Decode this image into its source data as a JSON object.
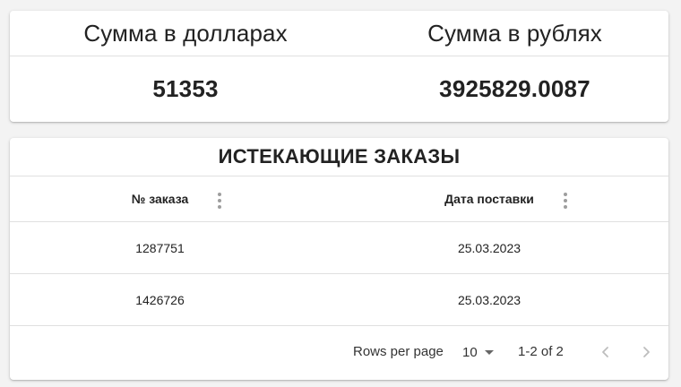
{
  "summary": {
    "usd_title": "Сумма в долларах",
    "rub_title": "Сумма в рублях",
    "usd_value": "51353",
    "rub_value": "3925829.0087"
  },
  "orders": {
    "title": "ИСТЕКАЮЩИЕ ЗАКАЗЫ",
    "columns": [
      "№ заказа",
      "Дата поставки"
    ],
    "rows": [
      {
        "order": "1287751",
        "date": "25.03.2023"
      },
      {
        "order": "1426726",
        "date": "25.03.2023"
      }
    ],
    "pagination": {
      "rows_per_page_label": "Rows per page",
      "rows_per_page_value": "10",
      "range_label": "1-2 of 2"
    }
  },
  "icons": {
    "column_menu": "more-vert-icon",
    "select_caret": "caret-down-icon",
    "prev": "chevron-left-icon",
    "next": "chevron-right-icon"
  },
  "colors": {
    "background": "#f3f3f3",
    "card": "#ffffff",
    "divider": "#e0e0e0",
    "text": "#222222",
    "icon_muted": "#bdbdbd"
  }
}
